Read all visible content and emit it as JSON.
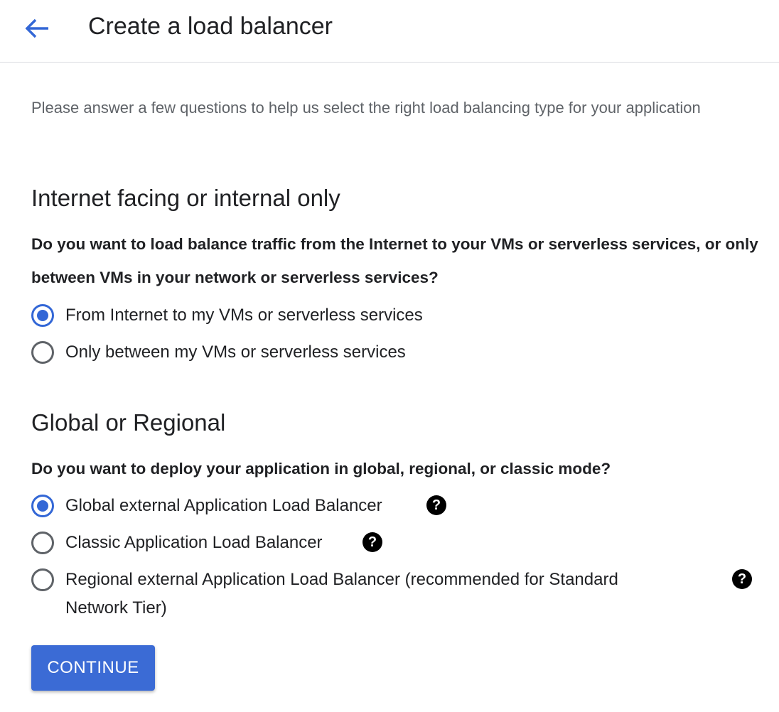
{
  "header": {
    "back_icon": "arrow-left-icon",
    "title": "Create a load balancer"
  },
  "intro": "Please answer a few questions to help us select the right load balancing type for your application",
  "section1": {
    "title": "Internet facing or internal only",
    "question": "Do you want to load balance traffic from the Internet to your VMs or serverless services, or only between VMs in your network or serverless services?",
    "options": [
      {
        "label": "From Internet to my VMs or serverless services",
        "selected": true
      },
      {
        "label": "Only between my VMs or serverless services",
        "selected": false
      }
    ]
  },
  "section2": {
    "title": "Global or Regional",
    "question": "Do you want to deploy your application in global, regional, or classic mode?",
    "options": [
      {
        "label": "Global external Application Load Balancer",
        "selected": true,
        "help_icon": "help-icon"
      },
      {
        "label": "Classic Application Load Balancer",
        "selected": false,
        "help_icon": "help-icon"
      },
      {
        "label": "Regional external Application Load Balancer (recommended for Standard Network Tier)",
        "selected": false,
        "help_icon": "help-icon"
      }
    ]
  },
  "help_glyph": "?",
  "continue_label": "CONTINUE",
  "colors": {
    "accent": "#3367d6",
    "button": "#3b6bd5",
    "text": "#202124",
    "secondary_text": "#5f6368"
  }
}
